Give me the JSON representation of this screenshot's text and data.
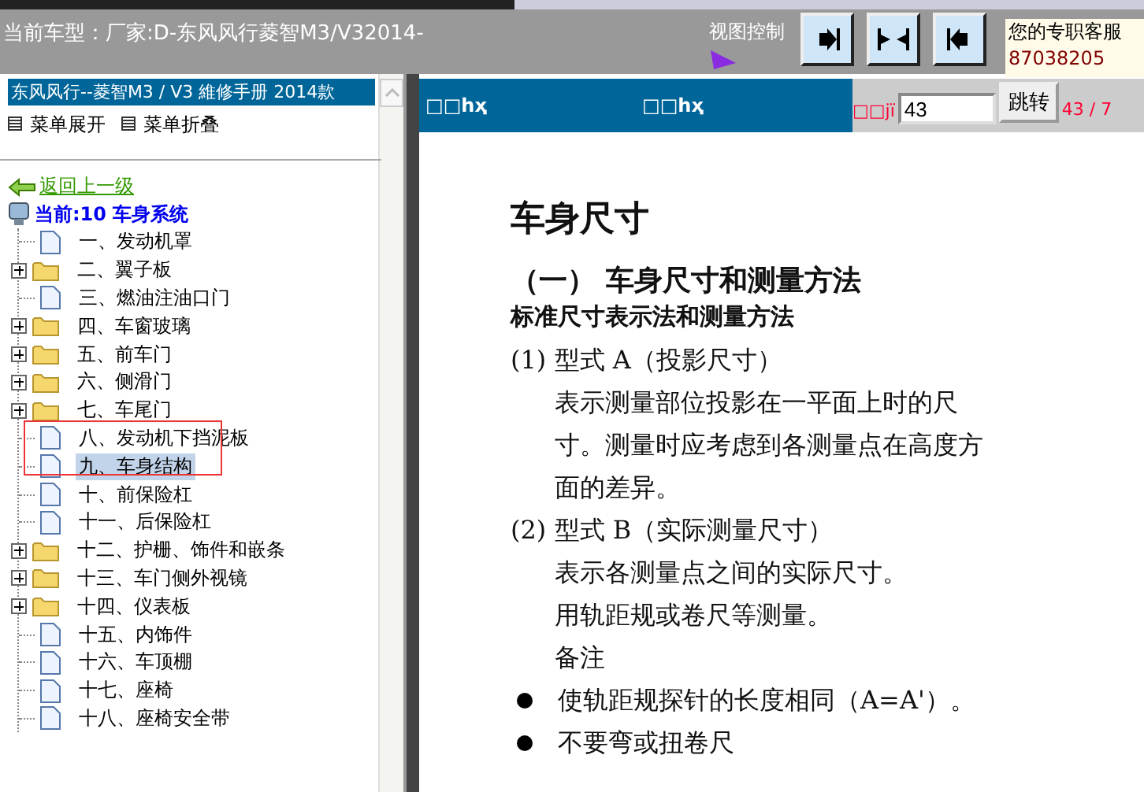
{
  "header": {
    "vehicle": "当前车型：厂家:D-东风风行菱智M3/V32014-",
    "view_control_label": "视图控制",
    "support": {
      "label": "您的专职客服",
      "phone": "87038205"
    }
  },
  "sidebar": {
    "title": "东风风行--菱智M3 / V3 維修手册  2014款",
    "menu_actions": [
      "菜单展开",
      "菜单折叠"
    ],
    "back_link": "返回上一级",
    "current": "当前:10 车身系统",
    "items": [
      {
        "label": "一、发动机罩",
        "kind": "page",
        "selected": false
      },
      {
        "label": "二、翼子板",
        "kind": "folder",
        "selected": false
      },
      {
        "label": "三、燃油注油口门",
        "kind": "page",
        "selected": false
      },
      {
        "label": "四、车窗玻璃",
        "kind": "folder",
        "selected": false
      },
      {
        "label": "五、前车门",
        "kind": "folder",
        "selected": false
      },
      {
        "label": "六、侧滑门",
        "kind": "folder",
        "selected": false
      },
      {
        "label": "七、车尾门",
        "kind": "folder",
        "selected": false
      },
      {
        "label": "八、发动机下挡泥板",
        "kind": "page",
        "selected": false
      },
      {
        "label": "九、车身结构",
        "kind": "page",
        "selected": true
      },
      {
        "label": "十、前保险杠",
        "kind": "page",
        "selected": false
      },
      {
        "label": "十一、后保险杠",
        "kind": "page",
        "selected": false
      },
      {
        "label": "十二、护栅、饰件和嵌条",
        "kind": "folder",
        "selected": false
      },
      {
        "label": "十三、车门侧外视镜",
        "kind": "folder",
        "selected": false
      },
      {
        "label": "十四、仪表板",
        "kind": "folder",
        "selected": false
      },
      {
        "label": "十五、内饰件",
        "kind": "page",
        "selected": false
      },
      {
        "label": "十六、车顶棚",
        "kind": "page",
        "selected": false
      },
      {
        "label": "十七、座椅",
        "kind": "page",
        "selected": false
      },
      {
        "label": "十八、座椅安全带",
        "kind": "page",
        "selected": false
      }
    ]
  },
  "document": {
    "header_texts": [
      "□□hҳ",
      "□□hҳ"
    ],
    "page_label": "□□jï",
    "page_input": "43",
    "jump_button": "跳转",
    "page_count": "43 / 7",
    "blocks": [
      {
        "kind": "title",
        "text": "车身尺寸"
      },
      {
        "kind": "heading",
        "text": "（一）  车身尺寸和测量方法"
      },
      {
        "kind": "subheading",
        "text": "标准尺寸表示法和测量方法"
      },
      {
        "kind": "item",
        "text": "(1)  型式 A（投影尺寸）"
      },
      {
        "kind": "para",
        "text": "表示测量部位投影在一平面上时的尺寸。测量时应考虑到各测量点在高度方面的差异。"
      },
      {
        "kind": "item",
        "text": "(2)  型式 B（实际测量尺寸）"
      },
      {
        "kind": "para",
        "text": "表示各测量点之间的实际尺寸。"
      },
      {
        "kind": "para",
        "text": "用轨距规或卷尺等测量。"
      },
      {
        "kind": "para",
        "text": "备注"
      },
      {
        "kind": "bullet",
        "text": "使轨距规探针的长度相同（A=A'）。"
      },
      {
        "kind": "bullet",
        "text": "不要弯或扭卷尺"
      }
    ]
  }
}
